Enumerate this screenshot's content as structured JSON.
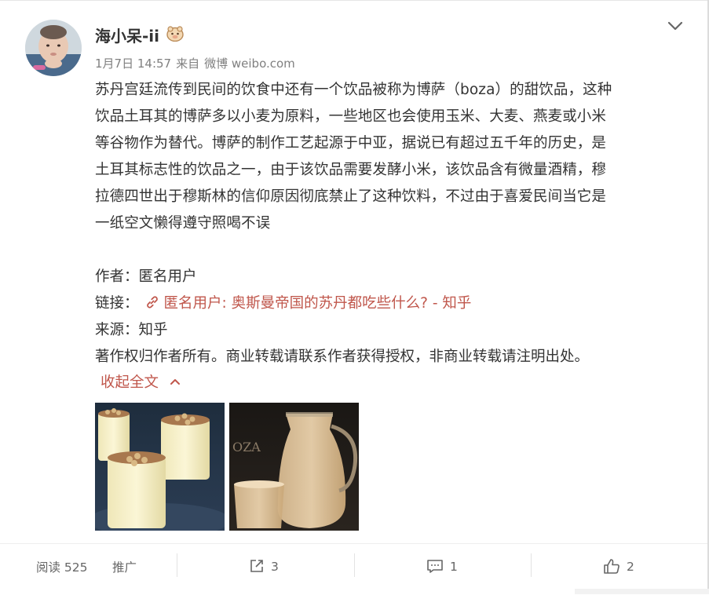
{
  "post": {
    "author": "海小呆-ii",
    "date": "1月7日 14:57",
    "source_prefix": "来自",
    "source": "微博 weibo.com",
    "body_lines": [
      "苏丹宫廷流传到民间的饮食中还有一个饮品被称为博萨（boza）的甜饮品，这种",
      "饮品土耳其的博萨多以小麦为原料，一些地区也会使用玉米、大麦、燕麦或小米",
      "等谷物作为替代。博萨的制作工艺起源于中亚，据说已有超过五千年的历史，是",
      "土耳其标志性的饮品之一，由于该饮品需要发酵小米，该饮品含有微量酒精，穆",
      "拉德四世出于穆斯林的信仰原因彻底禁止了这种饮料，不过由于喜爱民间当它是",
      "一纸空文懒得遵守照喝不误"
    ],
    "author_line": "作者：匿名用户",
    "link_label": "链接：",
    "link_text": "匿名用户: 奥斯曼帝国的苏丹都吃些什么? - 知乎",
    "source_line": "来源：知乎",
    "copyright": "著作权归作者所有。商业转载请联系作者获得授权，非商业转载请注明出处。",
    "collapse": "收起全文"
  },
  "footer": {
    "reads": "阅读 525",
    "promote": "推广",
    "reposts": "3",
    "comments": "1",
    "likes": "2"
  },
  "icons": {
    "more": "chevron-down-icon",
    "badge": "fan-badge-icon",
    "link": "link-icon",
    "repost": "repost-icon",
    "comment": "comment-icon",
    "like": "thumbs-up-icon"
  },
  "colors": {
    "link": "#c0574c",
    "meta": "#808080",
    "text": "#333333"
  }
}
